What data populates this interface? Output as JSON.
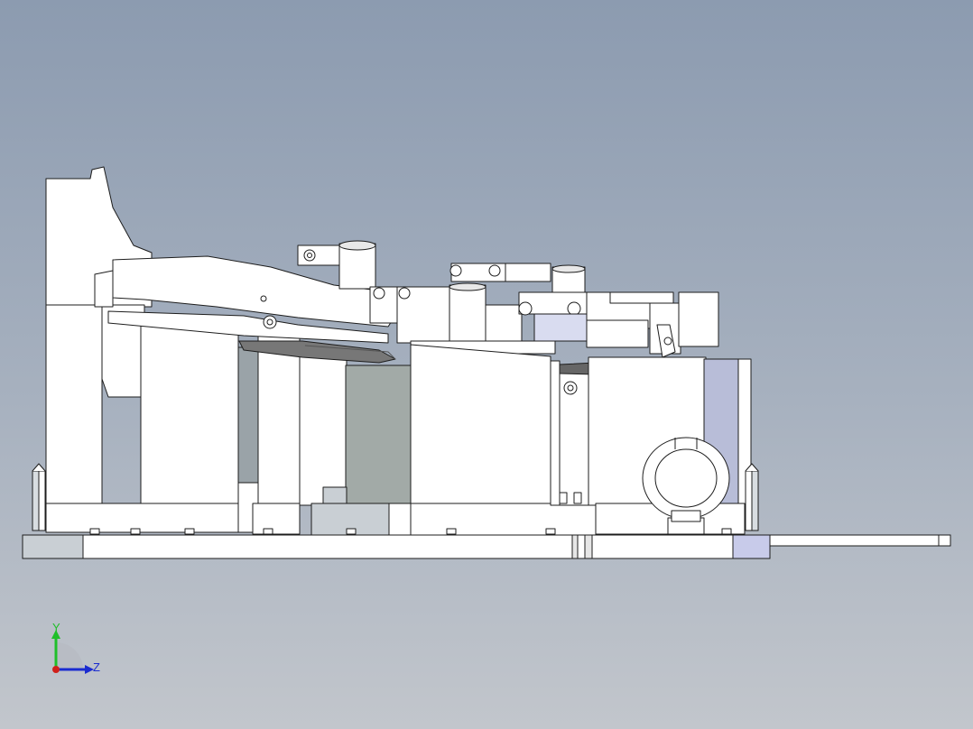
{
  "view": {
    "kind": "cad-3d-viewport",
    "background_top": "#8c9bb0",
    "background_bottom": "#c2c6cc",
    "model": "fixture-assembly",
    "orientation": "side-view"
  },
  "triad": {
    "y_label": "Y",
    "z_label": "Z",
    "y_color": "#1fbf2a",
    "z_color": "#1a2bd0",
    "x_color": "#d0201a"
  },
  "colors": {
    "part_face": "#ffffff",
    "part_shade": "#c9cfd4",
    "part_dark": "#9aa3a8",
    "part_blue": "#c8cbea",
    "edge": "#1d1d1d"
  }
}
